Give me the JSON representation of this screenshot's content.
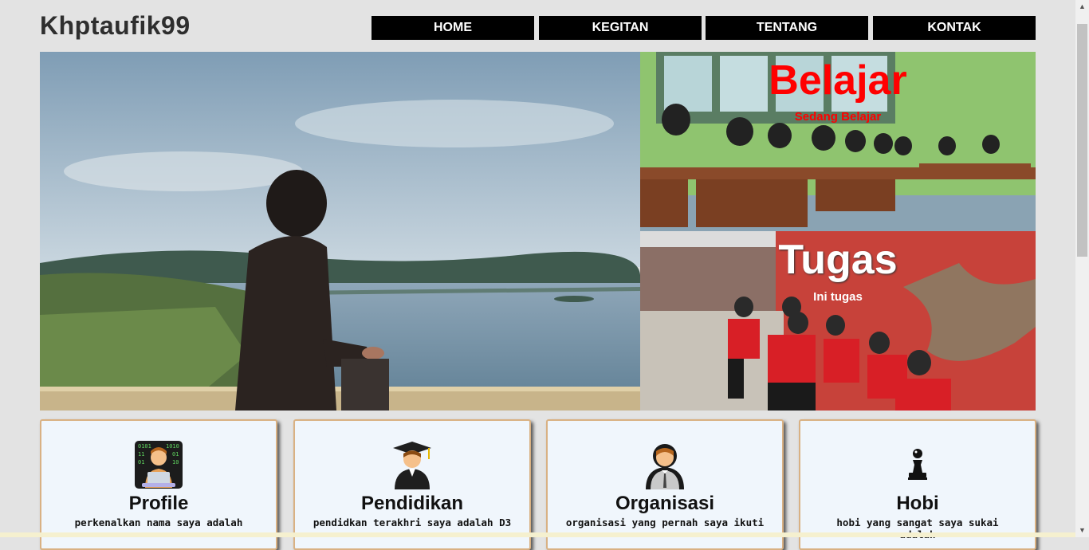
{
  "site": {
    "title": "Khptaufik99"
  },
  "nav": [
    {
      "label": "HOME"
    },
    {
      "label": "KEGITAN"
    },
    {
      "label": "TENTANG"
    },
    {
      "label": "KONTAK"
    }
  ],
  "hero": {
    "image": "person-overlooking-bay-photo"
  },
  "features": [
    {
      "title": "Belajar",
      "subtitle": "Sedang Belajar",
      "image": "classroom-students-photo"
    },
    {
      "title": "Tugas",
      "subtitle": "Ini tugas",
      "image": "group-of-students-photo"
    }
  ],
  "cards": [
    {
      "title": "Profile",
      "text": "perkenalkan nama saya adalah",
      "icon": "technologist-icon"
    },
    {
      "title": "Pendidikan",
      "text": "pendidkan terakhri saya adalah D3",
      "icon": "graduate-icon"
    },
    {
      "title": "Organisasi",
      "text": "organisasi yang pernah saya ikuti",
      "icon": "office-worker-icon"
    },
    {
      "title": "Hobi",
      "text": "hobi yang sangat saya sukai adalah",
      "icon": "chess-pawn-icon"
    }
  ],
  "colors": {
    "nav_bg": "#000000",
    "accent_red": "#ff0000",
    "card_bg": "#f0f6fc",
    "card_border": "#d9b183"
  }
}
